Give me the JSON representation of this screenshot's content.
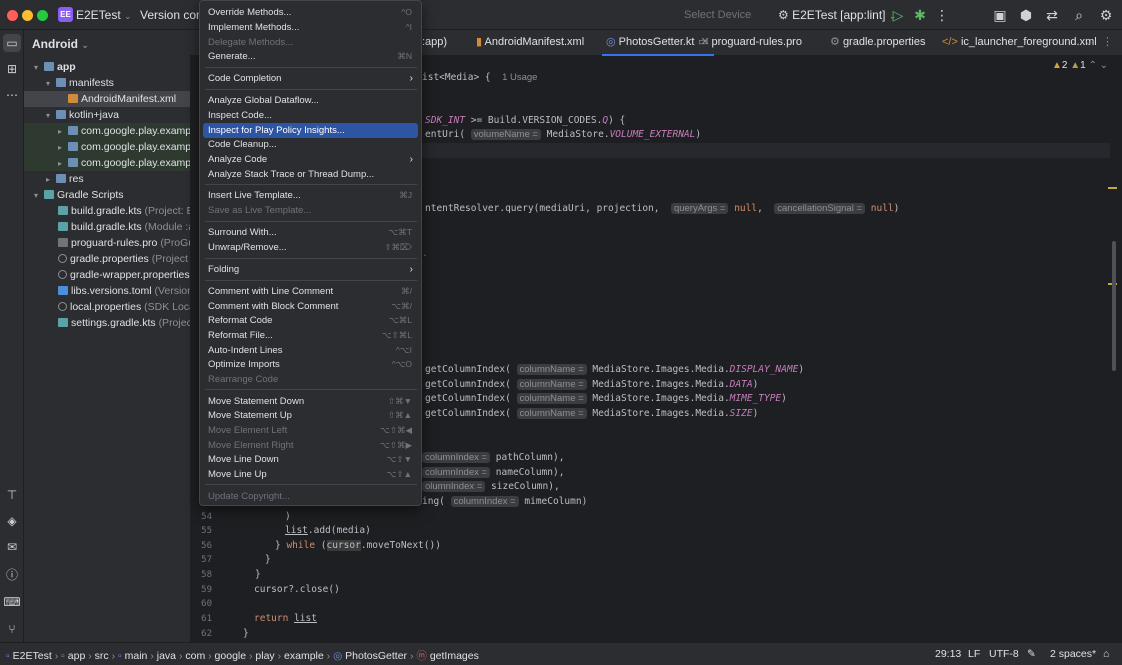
{
  "titlebar": {
    "project_badge": "EE",
    "project_name": "E2ETest",
    "version_control": "Version control",
    "select_device": "Select Device",
    "run_config": "E2ETest [app:lint]"
  },
  "project_panel": {
    "header": "Android",
    "tree": [
      {
        "label": "app",
        "detail": ""
      },
      {
        "label": "manifests",
        "detail": ""
      },
      {
        "label": "AndroidManifest.xml",
        "detail": ""
      },
      {
        "label": "kotlin+java",
        "detail": ""
      },
      {
        "label": "com.google.play.example",
        "detail": ""
      },
      {
        "label": "com.google.play.example",
        "detail": ""
      },
      {
        "label": "com.google.play.example",
        "detail": ""
      },
      {
        "label": "res",
        "detail": ""
      },
      {
        "label": "Gradle Scripts",
        "detail": ""
      },
      {
        "label": "build.gradle.kts",
        "detail": "(Project: E2E"
      },
      {
        "label": "build.gradle.kts",
        "detail": "(Module :app"
      },
      {
        "label": "proguard-rules.pro",
        "detail": "(ProGua"
      },
      {
        "label": "gradle.properties",
        "detail": "(Project Pr"
      },
      {
        "label": "gradle-wrapper.properties",
        "detail": "(C"
      },
      {
        "label": "libs.versions.toml",
        "detail": "(Version Ca"
      },
      {
        "label": "local.properties",
        "detail": "(SDK Locatio"
      },
      {
        "label": "settings.gradle.kts",
        "detail": "(Project S"
      }
    ]
  },
  "tabs": [
    {
      "label": ":app)"
    },
    {
      "label": "AndroidManifest.xml"
    },
    {
      "label": "PhotosGetter.kt"
    },
    {
      "label": "proguard-rules.pro"
    },
    {
      "label": "gradle.properties"
    },
    {
      "label": "ic_launcher_foreground.xml"
    }
  ],
  "editor": {
    "warnings": "2",
    "weak_warnings": "1",
    "usages": "1 Usage",
    "line_numbers": [
      "54",
      "55",
      "56",
      "57",
      "58",
      "59",
      "60",
      "61",
      "62"
    ]
  },
  "context_menu": {
    "items": [
      {
        "label": "Override Methods...",
        "shortcut": "^O",
        "disabled": false
      },
      {
        "label": "Implement Methods...",
        "shortcut": "^I",
        "disabled": false
      },
      {
        "label": "Delegate Methods...",
        "shortcut": "",
        "disabled": true
      },
      {
        "label": "Generate...",
        "shortcut": "⌘N",
        "disabled": false
      },
      {
        "label": "Code Completion",
        "shortcut": "",
        "disabled": false
      },
      {
        "label": "Analyze Global Dataflow...",
        "shortcut": "",
        "disabled": false
      },
      {
        "label": "Inspect Code...",
        "shortcut": "",
        "disabled": false
      },
      {
        "label": "Inspect for Play Policy Insights...",
        "shortcut": "",
        "disabled": false
      },
      {
        "label": "Code Cleanup...",
        "shortcut": "",
        "disabled": false
      },
      {
        "label": "Analyze Code",
        "shortcut": "",
        "disabled": false
      },
      {
        "label": "Analyze Stack Trace or Thread Dump...",
        "shortcut": "",
        "disabled": false
      },
      {
        "label": "Insert Live Template...",
        "shortcut": "⌘J",
        "disabled": false
      },
      {
        "label": "Save as Live Template...",
        "shortcut": "",
        "disabled": true
      },
      {
        "label": "Surround With...",
        "shortcut": "⌥⌘T",
        "disabled": false
      },
      {
        "label": "Unwrap/Remove...",
        "shortcut": "⇧⌘⌦",
        "disabled": false
      },
      {
        "label": "Folding",
        "shortcut": "",
        "disabled": false
      },
      {
        "label": "Comment with Line Comment",
        "shortcut": "⌘/",
        "disabled": false
      },
      {
        "label": "Comment with Block Comment",
        "shortcut": "⌥⌘/",
        "disabled": false
      },
      {
        "label": "Reformat Code",
        "shortcut": "⌥⌘L",
        "disabled": false
      },
      {
        "label": "Reformat File...",
        "shortcut": "⌥⇧⌘L",
        "disabled": false
      },
      {
        "label": "Auto-Indent Lines",
        "shortcut": "^⌥I",
        "disabled": false
      },
      {
        "label": "Optimize Imports",
        "shortcut": "^⌥O",
        "disabled": false
      },
      {
        "label": "Rearrange Code",
        "shortcut": "",
        "disabled": true
      },
      {
        "label": "Move Statement Down",
        "shortcut": "⇧⌘▼",
        "disabled": false
      },
      {
        "label": "Move Statement Up",
        "shortcut": "⇧⌘▲",
        "disabled": false
      },
      {
        "label": "Move Element Left",
        "shortcut": "⌥⇧⌘◀",
        "disabled": true
      },
      {
        "label": "Move Element Right",
        "shortcut": "⌥⇧⌘▶",
        "disabled": true
      },
      {
        "label": "Move Line Down",
        "shortcut": "⌥⇧▼",
        "disabled": false
      },
      {
        "label": "Move Line Up",
        "shortcut": "⌥⇧▲",
        "disabled": false
      },
      {
        "label": "Update Copyright...",
        "shortcut": "",
        "disabled": true
      }
    ]
  },
  "statusbar": {
    "breadcrumbs": [
      "E2ETest",
      "app",
      "src",
      "main",
      "java",
      "com",
      "google",
      "play",
      "example",
      "PhotosGetter",
      "getImages"
    ],
    "position": "29:13",
    "line_sep": "LF",
    "encoding": "UTF-8",
    "indent": "2 spaces*"
  }
}
